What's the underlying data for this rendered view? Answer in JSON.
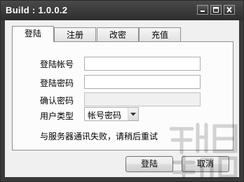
{
  "window": {
    "title": "Build : 1.0.0.2"
  },
  "tabs": [
    {
      "label": "登陆",
      "active": true
    },
    {
      "label": "注册",
      "active": false
    },
    {
      "label": "改密",
      "active": false
    },
    {
      "label": "充值",
      "active": false
    }
  ],
  "form": {
    "account_label": "登陆帐号",
    "account_value": "",
    "password_label": "登陆密码",
    "password_value": "",
    "confirm_label": "确认密码",
    "confirm_value": "",
    "user_type_label": "用户类型",
    "user_type_value": "帐号密码"
  },
  "status_message": "与服务器通讯失败，请稍后重试",
  "buttons": {
    "login": "登陆",
    "cancel": "取消"
  },
  "colors": {
    "titlebar": "#3a3a3a",
    "client_bg": "#f0f0f0"
  },
  "icons": {
    "minimize": "minimize-icon",
    "maximize": "maximize-icon",
    "close": "close-icon",
    "dropdown": "chevron-down-icon"
  }
}
